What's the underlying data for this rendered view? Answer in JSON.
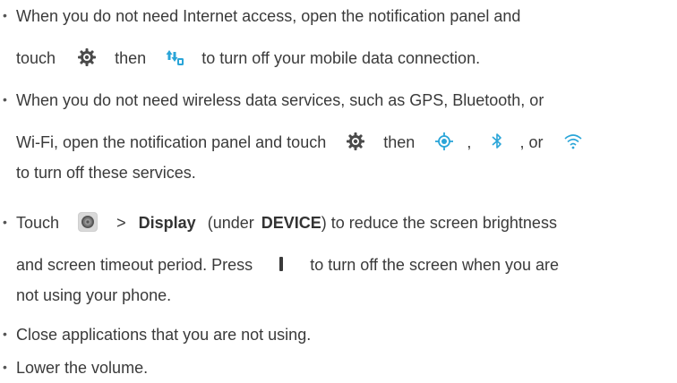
{
  "bullets": {
    "b1": {
      "line1": "When you do not need Internet access, open the notification panel and",
      "line2_pre": "touch",
      "line2_mid": "then",
      "line2_post": "to turn off your mobile data connection."
    },
    "b2": {
      "line1": "When you do not need wireless data services, such as GPS, Bluetooth, or",
      "line2_pre": "Wi-Fi, open the notification panel and touch",
      "line2_mid": "then",
      "line2_comma": ",",
      "line2_or": ", or",
      "line3": "to turn off these services."
    },
    "b3": {
      "line1_pre": "Touch",
      "line1_gt": ">",
      "line1_display": "Display",
      "line1_under": "(under",
      "line1_device": "DEVICE",
      "line1_post": ") to reduce the screen brightness",
      "line2_pre": "and screen timeout period. Press",
      "line2_post": "to turn off the screen when you are",
      "line3": "not using your phone."
    },
    "b4": {
      "line1": "Close applications that you are not using."
    },
    "b5": {
      "line1": "Lower the volume."
    }
  },
  "bullet_char": "•",
  "colors": {
    "text": "#3a3a3a",
    "icon_dark": "#4a4a4a",
    "icon_blue": "#2aa5d8"
  },
  "icons": [
    "settings-gear-icon",
    "mobile-data-icon",
    "gps-location-icon",
    "bluetooth-icon",
    "wifi-icon",
    "settings-app-icon",
    "power-button-icon"
  ]
}
